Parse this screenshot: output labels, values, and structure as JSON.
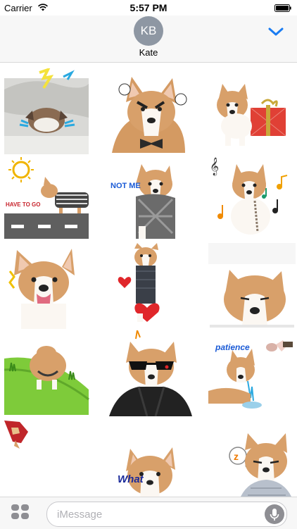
{
  "status": {
    "carrier": "Carrier",
    "time": "5:57 PM"
  },
  "contact": {
    "initials": "KB",
    "name": "Kate"
  },
  "stickers": [
    {
      "name": "corgi-under-blanket"
    },
    {
      "name": "angry-corgi-bowtie"
    },
    {
      "name": "corgi-with-gift"
    },
    {
      "name": "corgi-running-road",
      "caption": "HAVE TO GO"
    },
    {
      "name": "corgi-with-scarf",
      "caption": "NOT ME"
    },
    {
      "name": "corgi-with-music"
    },
    {
      "name": "happy-corgi-tongue"
    },
    {
      "name": "corgi-with-heart"
    },
    {
      "name": "sleepy-corgi"
    },
    {
      "name": "corgi-on-hill"
    },
    {
      "name": "corgi-sunglasses-jacket"
    },
    {
      "name": "corgi-patience",
      "caption": "patience"
    },
    {
      "name": "corgi-cape"
    },
    {
      "name": "corgi-what",
      "caption": "What"
    },
    {
      "name": "corgi-sleeping-z",
      "caption": "z"
    }
  ],
  "input": {
    "placeholder": "iMessage"
  },
  "icons": {
    "wifi": "wifi-icon",
    "battery": "battery-icon",
    "chevron": "chevron-down-icon",
    "apps": "app-drawer-icon",
    "mic": "microphone-icon"
  },
  "colors": {
    "accent": "#1a7cf2",
    "avatar": "#8e97a3"
  }
}
